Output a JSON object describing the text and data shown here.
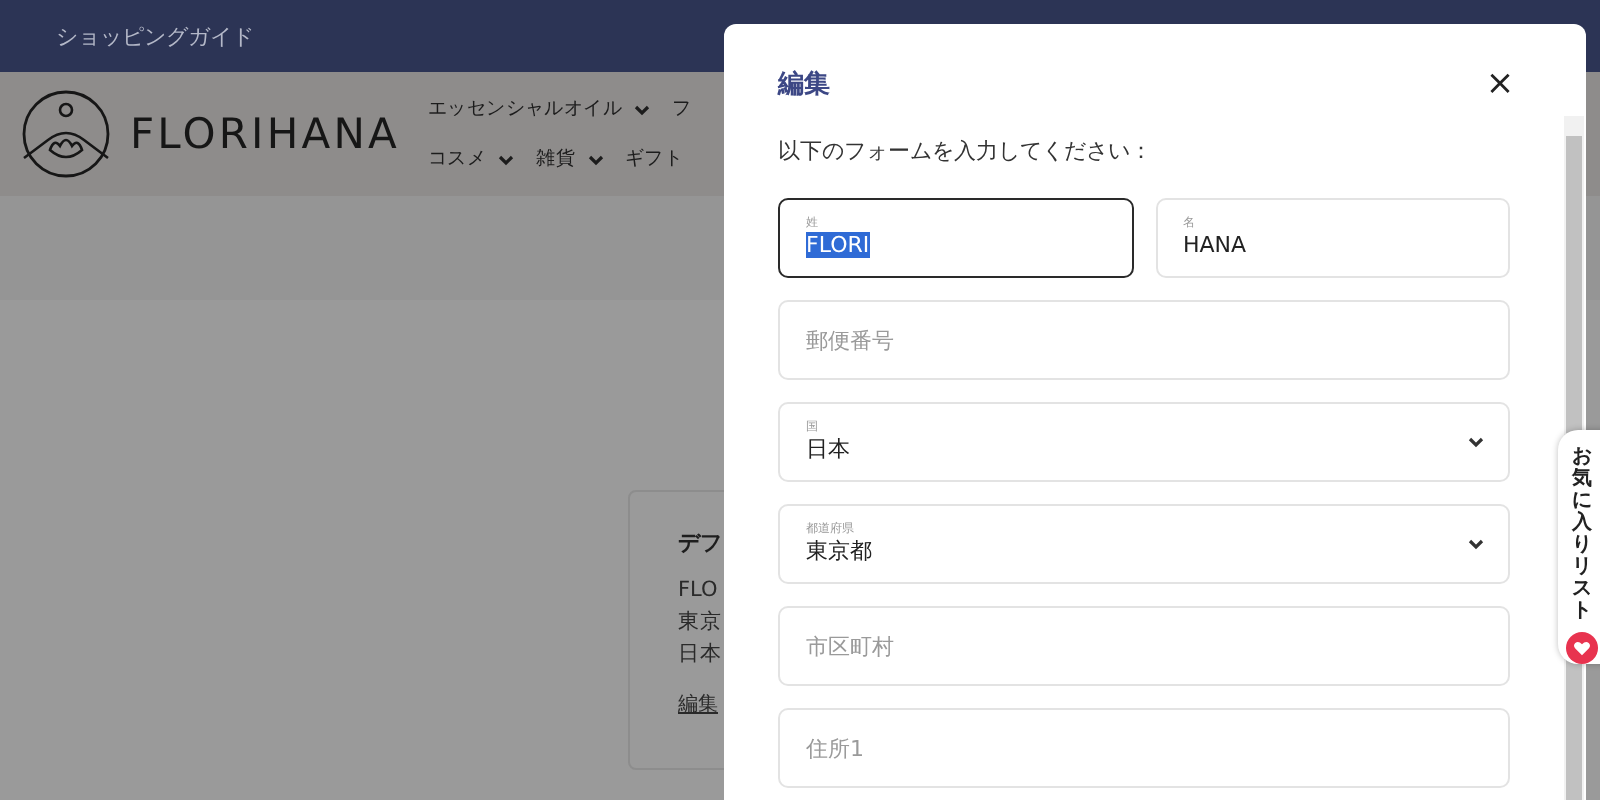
{
  "top_bar": {
    "link": "ショッピングガイド"
  },
  "header": {
    "logo_text": "FLORIHANA",
    "nav_rows": [
      [
        {
          "label": "エッセンシャルオイル",
          "has_menu": true
        },
        {
          "label": "フ",
          "has_menu": false
        }
      ],
      [
        {
          "label": "コスメ",
          "has_menu": true
        },
        {
          "label": "雑貨",
          "has_menu": true
        },
        {
          "label": "ギフト",
          "has_menu": false
        }
      ]
    ]
  },
  "address_card": {
    "title": "デフ",
    "lines": [
      "FLO",
      "東京",
      "日本"
    ],
    "edit_link": "編集"
  },
  "modal": {
    "title": "編集",
    "close": "×",
    "instruction": "以下のフォームを入力してください：",
    "field_rows": [
      [
        {
          "kind": "text",
          "label": "姓",
          "value": "FLORI",
          "focused": true
        },
        {
          "kind": "text",
          "label": "名",
          "value": "HANA",
          "focused": false
        }
      ],
      [
        {
          "kind": "text",
          "placeholder": "郵便番号",
          "focused": false
        }
      ],
      [
        {
          "kind": "select",
          "label": "国",
          "value": "日本",
          "focused": false
        }
      ],
      [
        {
          "kind": "select",
          "label": "都道府県",
          "value": "東京都",
          "focused": false
        }
      ],
      [
        {
          "kind": "text",
          "placeholder": "市区町村",
          "focused": false
        }
      ],
      [
        {
          "kind": "text",
          "placeholder": "住所1",
          "focused": false
        }
      ]
    ]
  },
  "wishlist_tab": {
    "label": "お気に入りリスト"
  }
}
